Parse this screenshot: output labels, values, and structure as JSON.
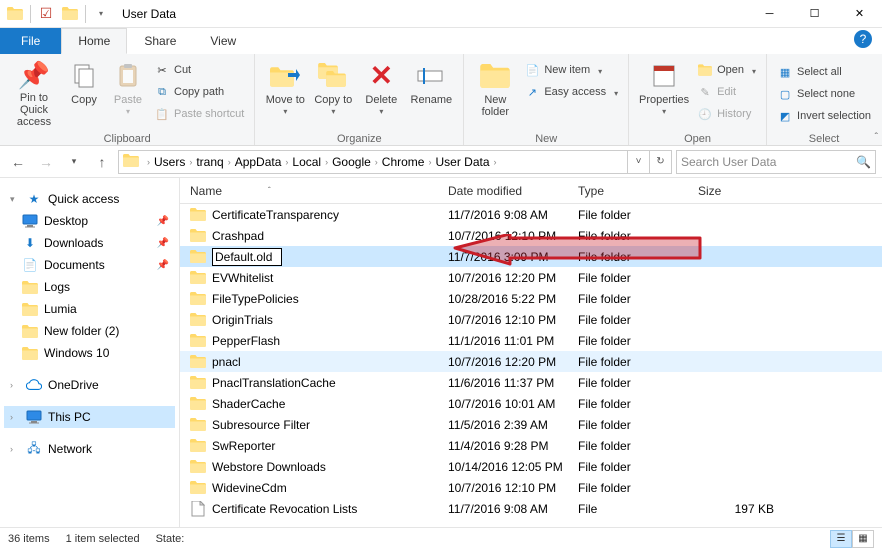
{
  "window": {
    "title": "User Data"
  },
  "tabs": {
    "file": "File",
    "home": "Home",
    "share": "Share",
    "view": "View"
  },
  "ribbon": {
    "clipboard": {
      "label": "Clipboard",
      "pin": "Pin to Quick access",
      "copy": "Copy",
      "paste": "Paste",
      "cut": "Cut",
      "copy_path": "Copy path",
      "paste_shortcut": "Paste shortcut"
    },
    "organize": {
      "label": "Organize",
      "move_to": "Move to",
      "copy_to": "Copy to",
      "delete": "Delete",
      "rename": "Rename"
    },
    "new": {
      "label": "New",
      "new_folder": "New folder",
      "new_item": "New item",
      "easy_access": "Easy access"
    },
    "open": {
      "label": "Open",
      "properties": "Properties",
      "open": "Open",
      "edit": "Edit",
      "history": "History"
    },
    "select": {
      "label": "Select",
      "select_all": "Select all",
      "select_none": "Select none",
      "invert": "Invert selection"
    }
  },
  "breadcrumb": [
    "Users",
    "tranq",
    "AppData",
    "Local",
    "Google",
    "Chrome",
    "User Data"
  ],
  "search_placeholder": "Search User Data",
  "nav": {
    "quick_access": "Quick access",
    "desktop": "Desktop",
    "downloads": "Downloads",
    "documents": "Documents",
    "logs": "Logs",
    "lumia": "Lumia",
    "new_folder2": "New folder (2)",
    "windows10": "Windows 10",
    "onedrive": "OneDrive",
    "this_pc": "This PC",
    "network": "Network"
  },
  "columns": {
    "name": "Name",
    "date": "Date modified",
    "type": "Type",
    "size": "Size"
  },
  "files": [
    {
      "name": "CertificateTransparency",
      "date": "11/7/2016 9:08 AM",
      "type": "File folder",
      "size": "",
      "kind": "folder"
    },
    {
      "name": "Crashpad",
      "date": "10/7/2016 12:10 PM",
      "type": "File folder",
      "size": "",
      "kind": "folder"
    },
    {
      "name": "Default.old",
      "date": "11/7/2016 3:09 PM",
      "type": "File folder",
      "size": "",
      "kind": "folder",
      "selected": true,
      "editing": true
    },
    {
      "name": "EVWhitelist",
      "date": "10/7/2016 12:20 PM",
      "type": "File folder",
      "size": "",
      "kind": "folder"
    },
    {
      "name": "FileTypePolicies",
      "date": "10/28/2016 5:22 PM",
      "type": "File folder",
      "size": "",
      "kind": "folder"
    },
    {
      "name": "OriginTrials",
      "date": "10/7/2016 12:10 PM",
      "type": "File folder",
      "size": "",
      "kind": "folder"
    },
    {
      "name": "PepperFlash",
      "date": "11/1/2016 11:01 PM",
      "type": "File folder",
      "size": "",
      "kind": "folder"
    },
    {
      "name": "pnacl",
      "date": "10/7/2016 12:20 PM",
      "type": "File folder",
      "size": "",
      "kind": "folder",
      "hover": true
    },
    {
      "name": "PnaclTranslationCache",
      "date": "11/6/2016 11:37 PM",
      "type": "File folder",
      "size": "",
      "kind": "folder"
    },
    {
      "name": "ShaderCache",
      "date": "10/7/2016 10:01 AM",
      "type": "File folder",
      "size": "",
      "kind": "folder"
    },
    {
      "name": "Subresource Filter",
      "date": "11/5/2016 2:39 AM",
      "type": "File folder",
      "size": "",
      "kind": "folder"
    },
    {
      "name": "SwReporter",
      "date": "11/4/2016 9:28 PM",
      "type": "File folder",
      "size": "",
      "kind": "folder"
    },
    {
      "name": "Webstore Downloads",
      "date": "10/14/2016 12:05 PM",
      "type": "File folder",
      "size": "",
      "kind": "folder"
    },
    {
      "name": "WidevineCdm",
      "date": "10/7/2016 12:10 PM",
      "type": "File folder",
      "size": "",
      "kind": "folder"
    },
    {
      "name": "Certificate Revocation Lists",
      "date": "11/7/2016 9:08 AM",
      "type": "File",
      "size": "197 KB",
      "kind": "file"
    }
  ],
  "status": {
    "count": "36 items",
    "selected": "1 item selected",
    "state": "State:"
  }
}
